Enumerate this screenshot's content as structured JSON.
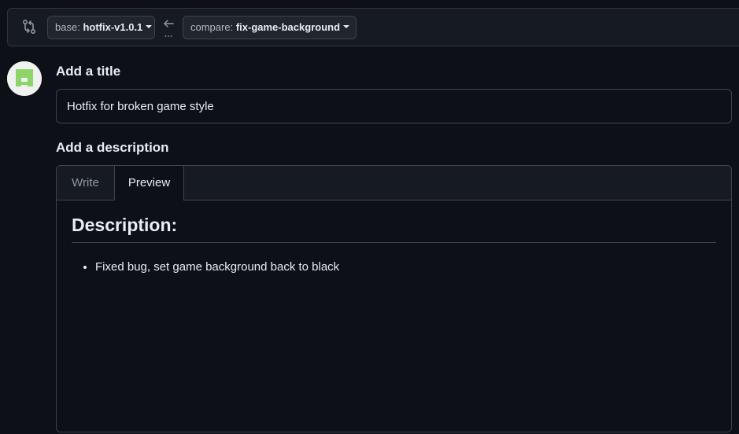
{
  "range": {
    "base_prefix": "base:",
    "base_branch": "hotfix-v1.0.1",
    "compare_prefix": "compare:",
    "compare_branch": "fix-game-background",
    "compare_icon": "git-compare-icon",
    "arrow_icon": "arrow-left-icon"
  },
  "form": {
    "title_label": "Add a title",
    "title_value": "Hotfix for broken game style",
    "description_label": "Add a description"
  },
  "editor": {
    "tabs": [
      {
        "label": "Write",
        "active": false
      },
      {
        "label": "Preview",
        "active": true
      }
    ],
    "preview": {
      "heading": "Description:",
      "items": [
        "Fixed bug, set game background back to black"
      ]
    }
  },
  "user": {
    "avatar_icon": "identicon-avatar",
    "avatar_color": "#8fd46b"
  },
  "colors": {
    "background": "#0d1117",
    "panel": "#161b22",
    "border": "#3d444d",
    "text": "#e6edf3",
    "muted": "#9198a1"
  }
}
